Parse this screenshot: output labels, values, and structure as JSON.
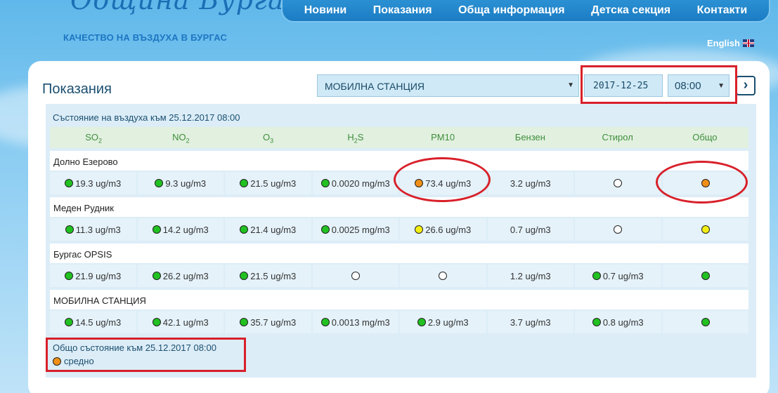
{
  "header": {
    "logo_title": "Община Бургас",
    "logo_subtitle": "КАЧЕСТВО НА ВЪЗДУХА В БУРГАС",
    "nav": [
      "Новини",
      "Показания",
      "Обща информация",
      "Детска секция",
      "Контакти"
    ],
    "language": "English"
  },
  "controls": {
    "page_title": "Показания",
    "station": "МОБИЛНА СТАНЦИЯ",
    "date": "2017-12-25",
    "hour": "08:00"
  },
  "table": {
    "status_title": "Състояние на въздуха към 25.12.2017 08:00",
    "columns": [
      {
        "label": "SO",
        "sub": "2"
      },
      {
        "label": "NO",
        "sub": "2"
      },
      {
        "label": "O",
        "sub": "3"
      },
      {
        "label": "H",
        "sub": "2",
        "after": "S"
      },
      {
        "label": "PM10",
        "sub": ""
      },
      {
        "label": "Бензен",
        "sub": ""
      },
      {
        "label": "Стирол",
        "sub": ""
      },
      {
        "label": "Общо",
        "sub": ""
      }
    ],
    "stations": [
      {
        "name": "Долно Езерово",
        "cells": [
          {
            "dot": "green",
            "value": "19.3 ug/m3"
          },
          {
            "dot": "green",
            "value": "9.3 ug/m3"
          },
          {
            "dot": "green",
            "value": "21.5 ug/m3"
          },
          {
            "dot": "green",
            "value": "0.0020 mg/m3"
          },
          {
            "dot": "orange",
            "value": "73.4 ug/m3"
          },
          {
            "dot": "",
            "value": "3.2 ug/m3"
          },
          {
            "dot": "empty",
            "value": ""
          },
          {
            "dot": "orange",
            "value": ""
          }
        ]
      },
      {
        "name": "Меден Рудник",
        "cells": [
          {
            "dot": "green",
            "value": "11.3 ug/m3"
          },
          {
            "dot": "green",
            "value": "14.2 ug/m3"
          },
          {
            "dot": "green",
            "value": "21.4 ug/m3"
          },
          {
            "dot": "green",
            "value": "0.0025 mg/m3"
          },
          {
            "dot": "yellow",
            "value": "26.6 ug/m3"
          },
          {
            "dot": "",
            "value": "0.7 ug/m3"
          },
          {
            "dot": "empty",
            "value": ""
          },
          {
            "dot": "yellow",
            "value": ""
          }
        ]
      },
      {
        "name": "Бургас OPSIS",
        "cells": [
          {
            "dot": "green",
            "value": "21.9 ug/m3"
          },
          {
            "dot": "green",
            "value": "26.2 ug/m3"
          },
          {
            "dot": "green",
            "value": "21.5 ug/m3"
          },
          {
            "dot": "empty",
            "value": ""
          },
          {
            "dot": "empty",
            "value": ""
          },
          {
            "dot": "",
            "value": "1.2 ug/m3"
          },
          {
            "dot": "green",
            "value": "0.7 ug/m3"
          },
          {
            "dot": "green",
            "value": ""
          }
        ]
      },
      {
        "name": "МОБИЛНА СТАНЦИЯ",
        "cells": [
          {
            "dot": "green",
            "value": "14.5 ug/m3"
          },
          {
            "dot": "green",
            "value": "42.1 ug/m3"
          },
          {
            "dot": "green",
            "value": "35.7 ug/m3"
          },
          {
            "dot": "green",
            "value": "0.0013 mg/m3"
          },
          {
            "dot": "green",
            "value": "2.9 ug/m3"
          },
          {
            "dot": "",
            "value": "3.7 ug/m3"
          },
          {
            "dot": "green",
            "value": "0.8 ug/m3"
          },
          {
            "dot": "green",
            "value": ""
          }
        ]
      }
    ],
    "overall_title": "Общо състояние към 25.12.2017 08:00",
    "overall_dot": "orange",
    "overall_label": "средно"
  },
  "colors": {
    "green": "#21c121",
    "orange": "#f08f16",
    "yellow": "#f4ef13",
    "highlight": "#d8202a"
  }
}
